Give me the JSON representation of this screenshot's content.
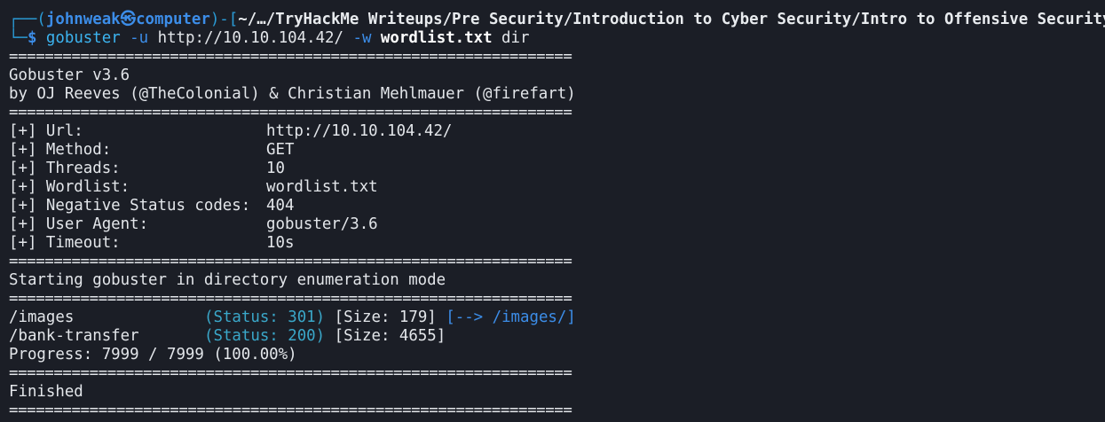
{
  "prompt": {
    "corner_top": "┌──(",
    "user": "johnweak",
    "skull": "㉿",
    "host": "computer",
    "mid": ")-[",
    "path": "~/…/TryHackMe Writeups/Pre Security/Introduction to Cyber Security/Intro to Offensive Security",
    "close": "]",
    "corner_bottom": "└─",
    "dollar": "$ ",
    "command": {
      "bin": "gobuster",
      "flag_u": "-u",
      "url": "http://10.10.104.42/",
      "flag_w": "-w",
      "wordlist": "wordlist.txt",
      "mode": "dir"
    }
  },
  "separator": "===============================================================",
  "banner": {
    "version": "Gobuster v3.6",
    "authors": "by OJ Reeves (@TheColonial) & Christian Mehlmauer (@firefart)"
  },
  "config": [
    {
      "key": "[+] Url:",
      "value": "http://10.10.104.42/"
    },
    {
      "key": "[+] Method:",
      "value": "GET"
    },
    {
      "key": "[+] Threads:",
      "value": "10"
    },
    {
      "key": "[+] Wordlist:",
      "value": "wordlist.txt"
    },
    {
      "key": "[+] Negative Status codes:",
      "value": "404"
    },
    {
      "key": "[+] User Agent:",
      "value": "gobuster/3.6"
    },
    {
      "key": "[+] Timeout:",
      "value": "10s"
    }
  ],
  "start_message": "Starting gobuster in directory enumeration mode",
  "results": [
    {
      "path": "/images",
      "status": "(Status: 301)",
      "size": "[Size: 179]",
      "redirect": "[--> /images/]"
    },
    {
      "path": "/bank-transfer",
      "status": "(Status: 200)",
      "size": "[Size: 4655]",
      "redirect": ""
    }
  ],
  "progress": "Progress: 7999 / 7999 (100.00%)",
  "finished": "Finished",
  "colors": {
    "background": "#1b1e26",
    "text": "#e3e6ea",
    "prompt_blue": "#3c8de8",
    "status_cyan": "#3aa7c9"
  }
}
